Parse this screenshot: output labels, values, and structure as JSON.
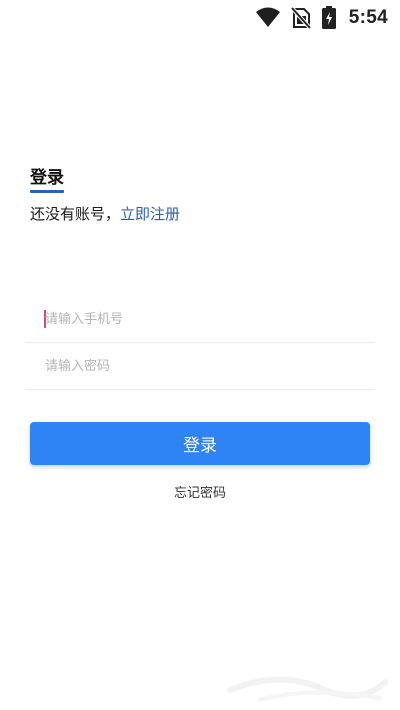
{
  "status_bar": {
    "time": "5:54",
    "icons": [
      "wifi-icon",
      "no-sim-icon",
      "battery-charging-icon"
    ]
  },
  "header": {
    "title": "登录",
    "no_account_text": "还没有账号，",
    "register_link": "立即注册",
    "accent_color": "#2a5fbf"
  },
  "form": {
    "phone": {
      "placeholder": "请输入手机号",
      "value": ""
    },
    "password": {
      "placeholder": "请输入密码",
      "value": ""
    }
  },
  "login_button": {
    "label": "登录",
    "color": "#2f84f5"
  },
  "forgot_password": "忘记密码"
}
